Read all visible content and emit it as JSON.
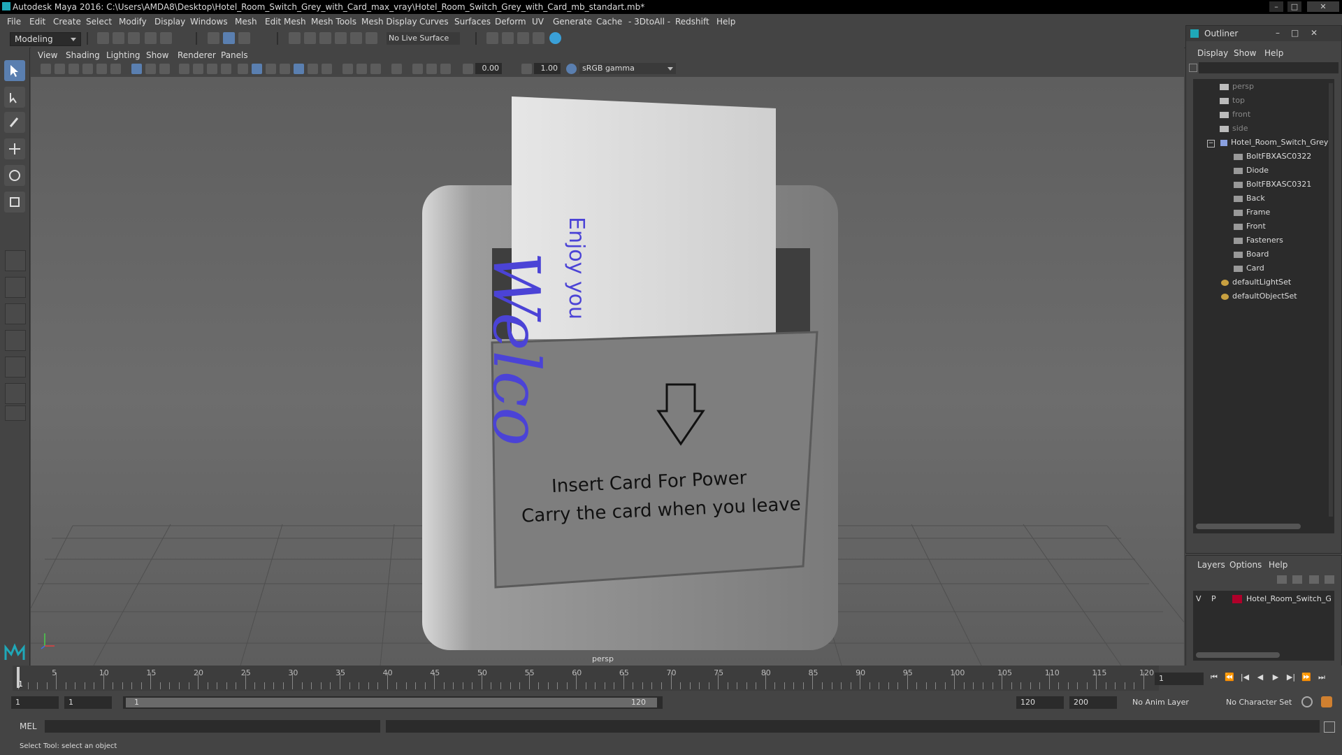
{
  "window": {
    "title": "Autodesk Maya 2016: C:\\Users\\AMDA8\\Desktop\\Hotel_Room_Switch_Grey_with_Card_max_vray\\Hotel_Room_Switch_Grey_with_Card_mb_standart.mb*",
    "minimize": "–",
    "maximize": "□",
    "close": "✕"
  },
  "menubar": [
    "File",
    "Edit",
    "Create",
    "Select",
    "Modify",
    "Display",
    "Windows",
    "Mesh",
    "Edit Mesh",
    "Mesh Tools",
    "Mesh Display",
    "Curves",
    "Surfaces",
    "Deform",
    "UV",
    "Generate",
    "Cache",
    "- 3DtoAll -",
    "Redshift",
    "Help"
  ],
  "toolbar": {
    "mode": "Modeling",
    "live_surface": "No Live Surface"
  },
  "viewport_menu": [
    "View",
    "Shading",
    "Lighting",
    "Show",
    "Renderer",
    "Panels"
  ],
  "viewport_tools": {
    "exposure": "0.00",
    "gamma_value": "1.00",
    "color_space": "sRGB gamma"
  },
  "viewport": {
    "camera_label": "persp",
    "card_text_big": "Welco",
    "card_text_small": "Enjoy you",
    "switch_line1": "Insert Card For Power",
    "switch_line2": "Carry the card when you leave"
  },
  "outliner": {
    "title": "Outliner",
    "tabs": [
      "Display",
      "Show",
      "Help"
    ],
    "cameras": [
      "persp",
      "top",
      "front",
      "side"
    ],
    "group": "Hotel_Room_Switch_Grey",
    "children": [
      "BoltFBXASC0322",
      "Diode",
      "BoltFBXASC0321",
      "Back",
      "Frame",
      "Front",
      "Fasteners",
      "Board",
      "Card"
    ],
    "sets": [
      "defaultLightSet",
      "defaultObjectSet"
    ]
  },
  "layers": {
    "tabs": [
      "Layers",
      "Options",
      "Help"
    ],
    "row": {
      "v": "V",
      "p": "P",
      "name": "Hotel_Room_Switch_G",
      "color": "#b0002a"
    }
  },
  "timeline": {
    "ticks": [
      "5",
      "10",
      "15",
      "20",
      "25",
      "30",
      "35",
      "40",
      "45",
      "50",
      "55",
      "60",
      "65",
      "70",
      "75",
      "80",
      "85",
      "90",
      "95",
      "100",
      "105",
      "110",
      "115",
      "120"
    ],
    "start_tick": "1",
    "current_frame": "1"
  },
  "range": {
    "start": "1",
    "playback_start": "1",
    "range_start_label": "1",
    "range_end_label": "120",
    "playback_end": "120",
    "end": "200",
    "anim_layer": "No Anim Layer",
    "character_set": "No Character Set"
  },
  "command": {
    "lang": "MEL",
    "help": "Select Tool: select an object"
  },
  "colors": {
    "accent": "#5a7fb0",
    "card_text": "#4b43d6",
    "layer_color": "#b0002a"
  }
}
